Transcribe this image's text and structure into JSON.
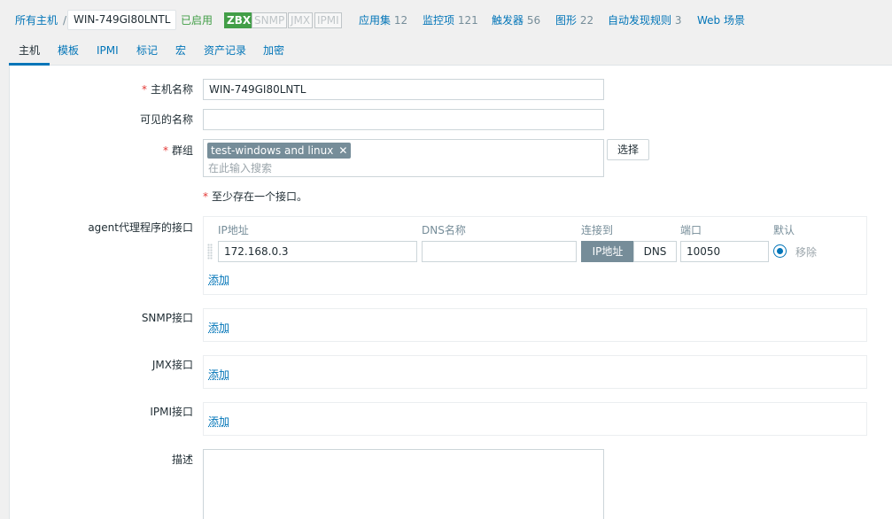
{
  "breadcrumb": {
    "all_hosts": "所有主机",
    "separator": "/",
    "host": "WIN-749GI80LNTL",
    "status": "已启用",
    "availability": [
      "ZBX",
      "SNMP",
      "JMX",
      "IPMI"
    ],
    "links": [
      {
        "label": "应用集",
        "count": "12"
      },
      {
        "label": "监控项",
        "count": "121"
      },
      {
        "label": "触发器",
        "count": "56"
      },
      {
        "label": "图形",
        "count": "22"
      },
      {
        "label": "自动发现规则",
        "count": "3"
      },
      {
        "label": "Web 场景",
        "count": ""
      }
    ]
  },
  "tabs": [
    "主机",
    "模板",
    "IPMI",
    "标记",
    "宏",
    "资产记录",
    "加密"
  ],
  "form": {
    "host_name_label": "主机名称",
    "host_name_value": "WIN-749GI80LNTL",
    "visible_name_label": "可见的名称",
    "visible_name_value": "",
    "groups_label": "群组",
    "group_chip": "test-windows and linux",
    "groups_placeholder": "在此输入搜索",
    "select_button": "选择",
    "interface_note": "至少存在一个接口。",
    "agent_label": "agent代理程序的接口",
    "columns": [
      "IP地址",
      "DNS名称",
      "连接到",
      "端口",
      "默认"
    ],
    "agent_ip": "172.168.0.3",
    "agent_dns": "",
    "connect_ip": "IP地址",
    "connect_dns": "DNS",
    "agent_port": "10050",
    "remove": "移除",
    "add": "添加",
    "snmp_label": "SNMP接口",
    "jmx_label": "JMX接口",
    "ipmi_label": "IPMI接口",
    "description_label": "描述",
    "description_value": ""
  },
  "colors": {
    "link": "#0275b8",
    "enabled": "#429e47",
    "required": "#e33734",
    "chip": "#768d99"
  }
}
